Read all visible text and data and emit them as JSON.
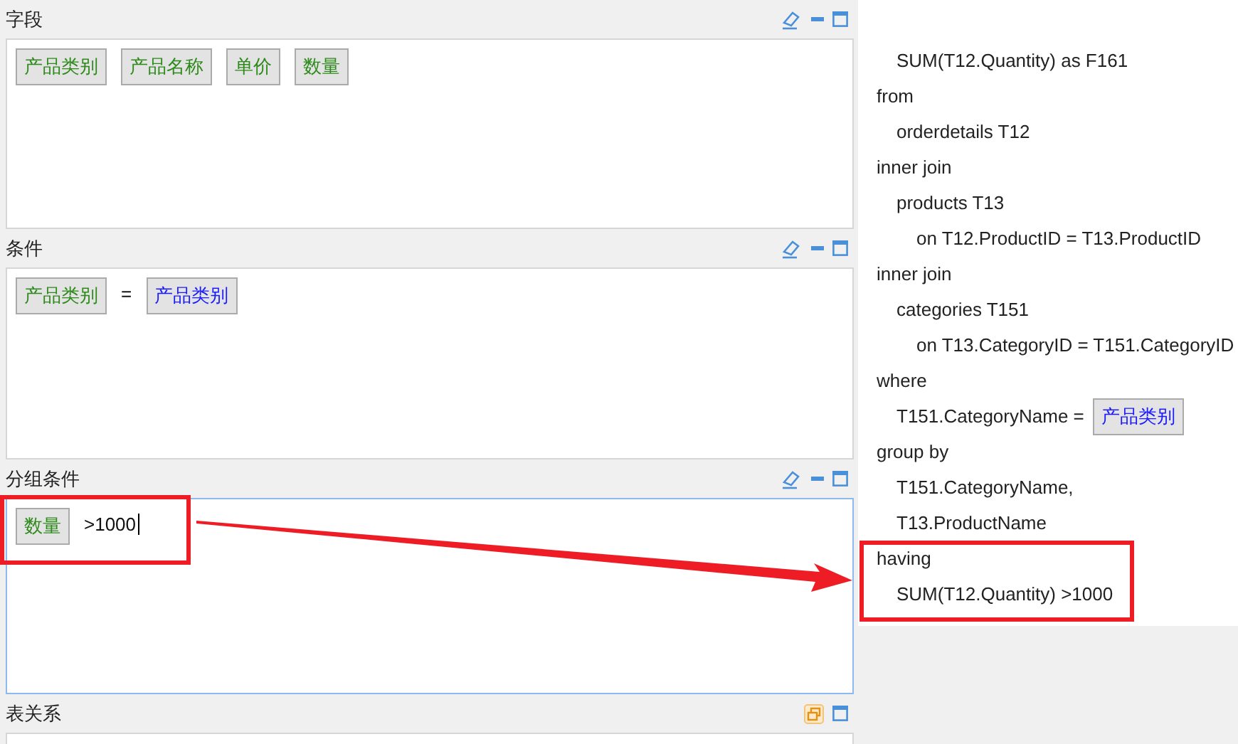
{
  "panels": [
    {
      "title": "字段",
      "kind": "fields",
      "focused": false,
      "chips": [
        {
          "label": "产品类别",
          "kind": "field"
        },
        {
          "label": "产品名称",
          "kind": "field"
        },
        {
          "label": "单价",
          "kind": "field"
        },
        {
          "label": "数量",
          "kind": "field"
        }
      ]
    },
    {
      "title": "条件",
      "kind": "condition",
      "focused": false,
      "left": {
        "label": "产品类别",
        "kind": "field"
      },
      "operator": "=",
      "right": {
        "label": "产品类别",
        "kind": "param"
      }
    },
    {
      "title": "分组条件",
      "kind": "having",
      "focused": true,
      "chip": {
        "label": "数量",
        "kind": "field"
      },
      "value": ">1000"
    },
    {
      "title": "表关系",
      "kind": "relations",
      "focused": false
    }
  ],
  "sql": [
    {
      "children": [
        {
          "text": "SUM(T12.Quantity) as F161"
        }
      ]
    },
    {
      "text": "from",
      "children": [
        {
          "text": "orderdetails T12"
        }
      ]
    },
    {
      "text": "inner join",
      "children": [
        {
          "text": "products T13",
          "children": [
            {
              "text": "on T12.ProductID = T13.ProductID"
            }
          ]
        }
      ]
    },
    {
      "text": "inner join",
      "children": [
        {
          "text": "categories T151",
          "children": [
            {
              "text": "on T13.CategoryID = T151.CategoryID"
            }
          ]
        }
      ]
    },
    {
      "text": "where",
      "children": [
        {
          "text": "T151.CategoryName =",
          "param": "产品类别"
        }
      ]
    },
    {
      "text": "group by",
      "children": [
        {
          "text": "T151.CategoryName,"
        },
        {
          "text": "T13.ProductName"
        }
      ]
    },
    {
      "text": "having",
      "children": [
        {
          "text": "SUM(T12.Quantity) >1000"
        }
      ]
    }
  ]
}
